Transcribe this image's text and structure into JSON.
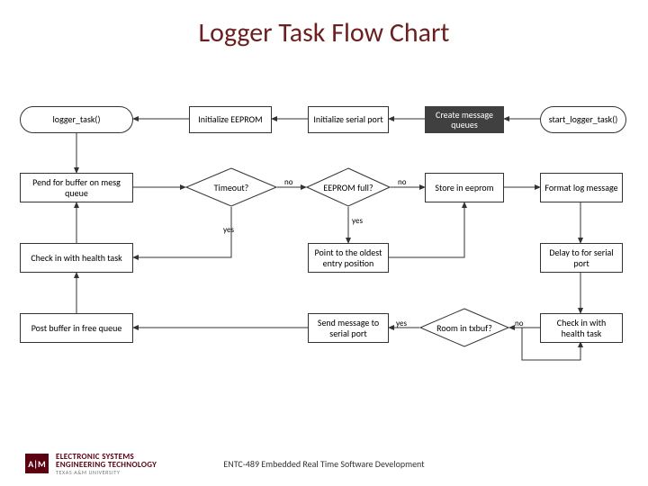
{
  "title": "Logger Task Flow Chart",
  "footer": "ENTC-489 Embedded Real Time Software Development",
  "logo": {
    "mark": "A|M",
    "line1a": "ELECTRONIC SYSTEMS",
    "line1b": "ENGINEERING TECHNOLOGY",
    "line2": "TEXAS A&M UNIVERSITY"
  },
  "nodes": {
    "start_logger": "start_logger_task()",
    "create_queues": "Create message queues",
    "init_serial": "Initialize serial port",
    "init_eeprom": "Initialize EEPROM",
    "logger_task": "logger_task()",
    "pend_buffer": "Pend for buffer on mesg queue",
    "timeout": "Timeout?",
    "eeprom_full": "EEPROM full?",
    "store_eeprom": "Store in eeprom",
    "format_log": "Format log message",
    "checkin_health1": "Check in with health task",
    "point_oldest": "Point to the oldest entry position",
    "delay_serial": "Delay to for serial port",
    "post_buffer": "Post buffer in free queue",
    "send_serial": "Send message to serial port",
    "room_txbuf": "Room in txbuf?",
    "checkin_health2": "Check in with health task"
  },
  "edge_labels": {
    "yes": "yes",
    "no": "no"
  }
}
